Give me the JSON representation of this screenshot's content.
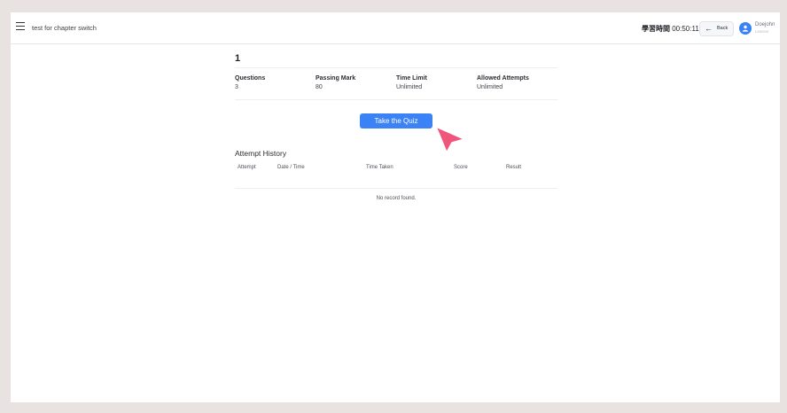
{
  "header": {
    "course_title": "test for chapter switch",
    "timer_label": "學習時間",
    "timer_value": "00:50:11",
    "back_label": "Back",
    "user_name": "Doejohn",
    "user_role": "Learner"
  },
  "quiz": {
    "title": "1",
    "stats": [
      {
        "label": "Questions",
        "value": "3"
      },
      {
        "label": "Passing Mark",
        "value": "80"
      },
      {
        "label": "Time Limit",
        "value": "Unlimited"
      },
      {
        "label": "Allowed Attempts",
        "value": "Unlimited"
      }
    ],
    "take_button": "Take the Quiz"
  },
  "history": {
    "title": "Attempt History",
    "columns": [
      "Attempt",
      "Date / Time",
      "Time Taken",
      "Score",
      "Result"
    ],
    "empty_message": "No record found."
  },
  "colors": {
    "accent": "#3b82f6",
    "pointer": "#f0557a",
    "page_background": "#e8e2e0"
  },
  "icons": {
    "menu": "menu-icon",
    "back": "arrow-left-icon",
    "avatar": "user-icon",
    "pointer": "cursor-pointer-icon"
  }
}
